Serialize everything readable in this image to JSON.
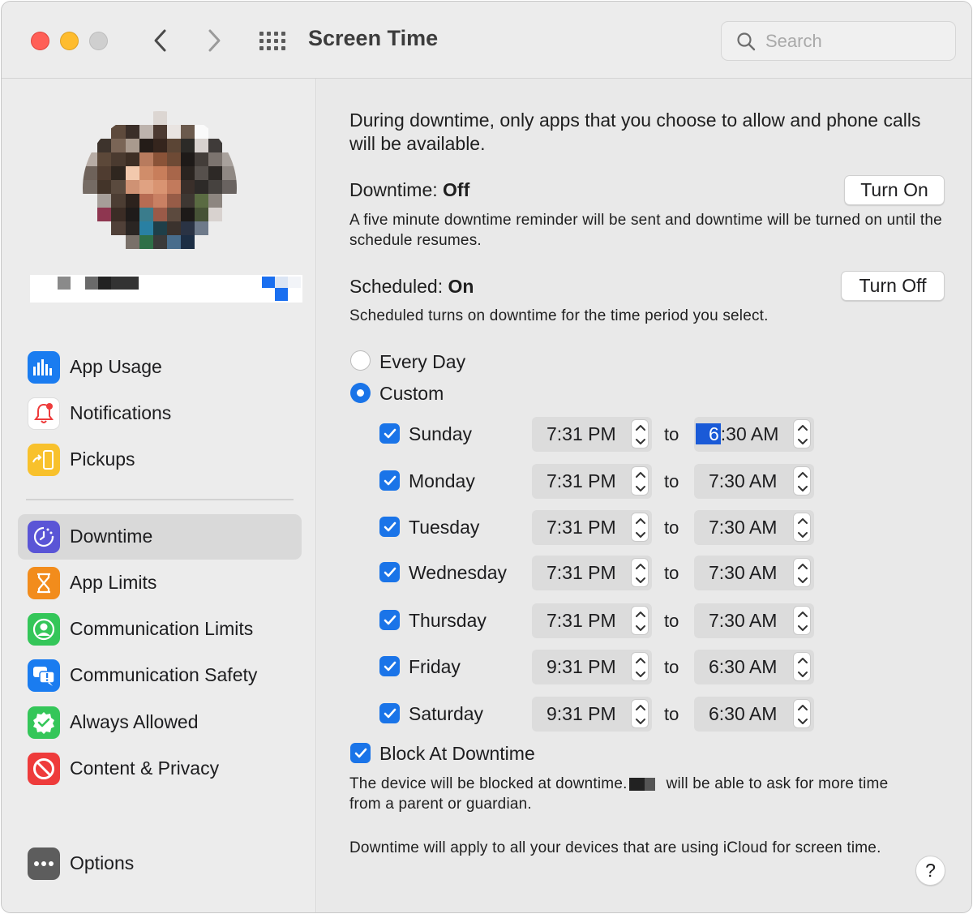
{
  "window": {
    "title": "Screen Time"
  },
  "search": {
    "placeholder": "Search"
  },
  "sidebar": {
    "items": [
      {
        "label": "App Usage",
        "icon": "bar-chart-icon",
        "color": "#1a7cf0"
      },
      {
        "label": "Notifications",
        "icon": "bell-icon",
        "color": "#ffffff"
      },
      {
        "label": "Pickups",
        "icon": "phone-pickup-icon",
        "color": "#f8c12c"
      },
      {
        "label": "Downtime",
        "icon": "downtime-icon",
        "color": "#5a55d6",
        "selected": true
      },
      {
        "label": "App Limits",
        "icon": "hourglass-icon",
        "color": "#f28c1c"
      },
      {
        "label": "Communication Limits",
        "icon": "person-circle-icon",
        "color": "#34c659"
      },
      {
        "label": "Communication Safety",
        "icon": "speech-bubble-icon",
        "color": "#1a7cf0"
      },
      {
        "label": "Always Allowed",
        "icon": "checkmark-badge-icon",
        "color": "#34c659"
      },
      {
        "label": "Content & Privacy",
        "icon": "no-entry-icon",
        "color": "#ee3b3b"
      }
    ],
    "options_label": "Options"
  },
  "main": {
    "intro": "During downtime, only apps that you choose to allow and phone calls will be available.",
    "downtime_label": "Downtime:",
    "downtime_status": "Off",
    "turn_on_label": "Turn On",
    "downtime_desc": "A five minute downtime reminder will be sent and downtime will be turned on until the schedule resumes.",
    "scheduled_label": "Scheduled:",
    "scheduled_status": "On",
    "turn_off_label": "Turn Off",
    "scheduled_desc": "Scheduled turns on downtime for the time period you select.",
    "every_day_label": "Every Day",
    "custom_label": "Custom",
    "schedule_mode": "Custom",
    "to_label": "to",
    "days": [
      {
        "day": "Sunday",
        "checked": true,
        "from": "7:31 PM",
        "to_hl": "6",
        "to_rest": ":30 AM"
      },
      {
        "day": "Monday",
        "checked": true,
        "from": "7:31 PM",
        "to": "7:30 AM"
      },
      {
        "day": "Tuesday",
        "checked": true,
        "from": "7:31 PM",
        "to": "7:30 AM"
      },
      {
        "day": "Wednesday",
        "checked": true,
        "from": "7:31 PM",
        "to": "7:30 AM"
      },
      {
        "day": "Thursday",
        "checked": true,
        "from": "7:31 PM",
        "to": "7:30 AM"
      },
      {
        "day": "Friday",
        "checked": true,
        "from": "9:31 PM",
        "to": "6:30 AM"
      },
      {
        "day": "Saturday",
        "checked": true,
        "from": "9:31 PM",
        "to": "6:30 AM"
      }
    ],
    "block_label": "Block At Downtime",
    "block_checked": true,
    "block_desc_a": "The device will be blocked at downtime.",
    "block_desc_b": "will be able to ask for more time",
    "block_desc_c": "from a parent or guardian.",
    "icloud_note": "Downtime will apply to all your devices that are using iCloud for screen time.",
    "help_label": "?"
  },
  "colors": {
    "accent": "#1a74e8",
    "selection": "#1a5ad7"
  }
}
